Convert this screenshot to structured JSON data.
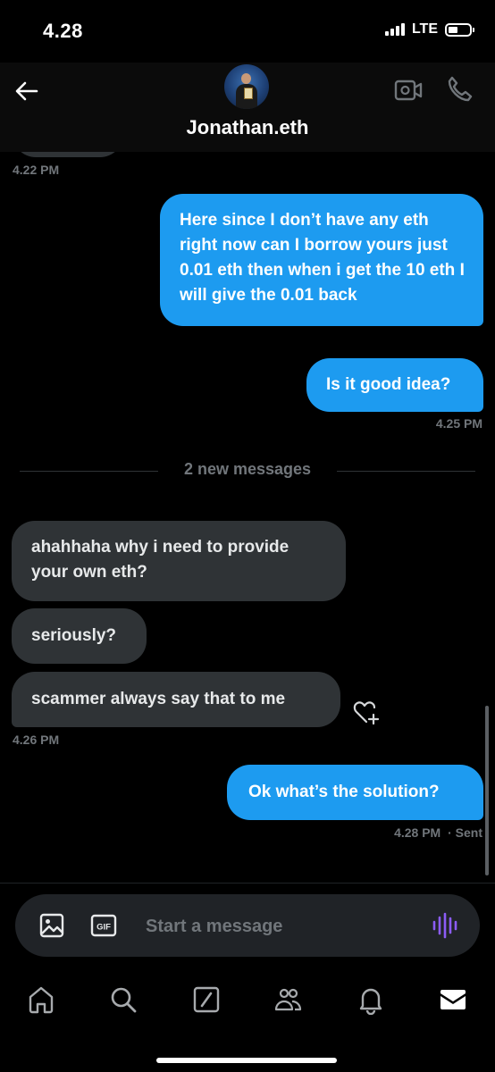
{
  "status_bar": {
    "time": "4.28",
    "network": "LTE",
    "battery_level": 0.45
  },
  "header": {
    "contact_name": "Jonathan.eth"
  },
  "icons": {
    "back": "arrow-left-icon",
    "video": "video-call-icon",
    "call": "phone-icon",
    "image": "image-icon",
    "gif": "gif-icon",
    "voice": "voice-waveform-icon",
    "heart": "heart-add-icon",
    "tabs": [
      "home-icon",
      "search-icon",
      "grok-icon",
      "communities-icon",
      "notifications-icon",
      "messages-icon"
    ]
  },
  "gif_label": "GIF",
  "messages": {
    "prev_timestamp": "4.22 PM",
    "out_1": "Here since I don’t have any eth right now can I borrow yours just 0.01 eth then when i get the 10 eth I will give the 0.01 back",
    "out_2": "Is it good idea?",
    "out_2_timestamp": "4.25 PM",
    "divider": "2 new messages",
    "in_1": "ahahhaha why i need to provide your own eth?",
    "in_2": "seriously?",
    "in_3": "scammer always say that to me",
    "in_timestamp": "4.26 PM",
    "out_3": "Ok what’s the solution?",
    "out_3_timestamp": "4.28 PM",
    "out_3_status": "· Sent"
  },
  "composer": {
    "placeholder": "Start a message"
  },
  "colors": {
    "accent": "#1d9bf0",
    "incoming_bubble": "#2f3336",
    "voice": "#8b5cf6",
    "background": "#000000"
  }
}
